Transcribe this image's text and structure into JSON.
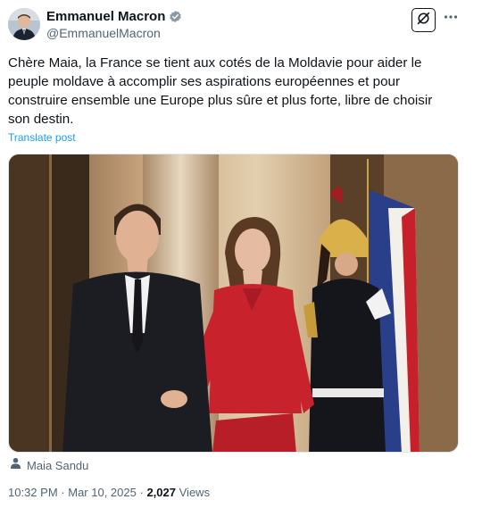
{
  "author": {
    "display_name": "Emmanuel Macron",
    "handle": "@EmmanuelMacron",
    "verified": true
  },
  "icons": {
    "verified": "verified-badge-icon",
    "grok": "grok-icon",
    "more": "more-icon",
    "tag": "person-icon"
  },
  "post": {
    "text": "Chère Maia, la France se tient aux cotés de la Moldavie pour aider le\npeuple moldave à accomplir ses aspirations européennes et pour\nconstruire ensemble une Europe plus sûre et plus forte, libre de choisir\nson destin.",
    "translate_label": "Translate post",
    "tagged_person": "Maia Sandu"
  },
  "meta": {
    "time": "10:32 PM",
    "separator": "·",
    "date": "Mar 10, 2025",
    "views_count": "2,027",
    "views_label": "Views"
  },
  "colors": {
    "link": "#1d9bf0",
    "secondary_text": "#536471",
    "verified": "#8b98a5"
  }
}
